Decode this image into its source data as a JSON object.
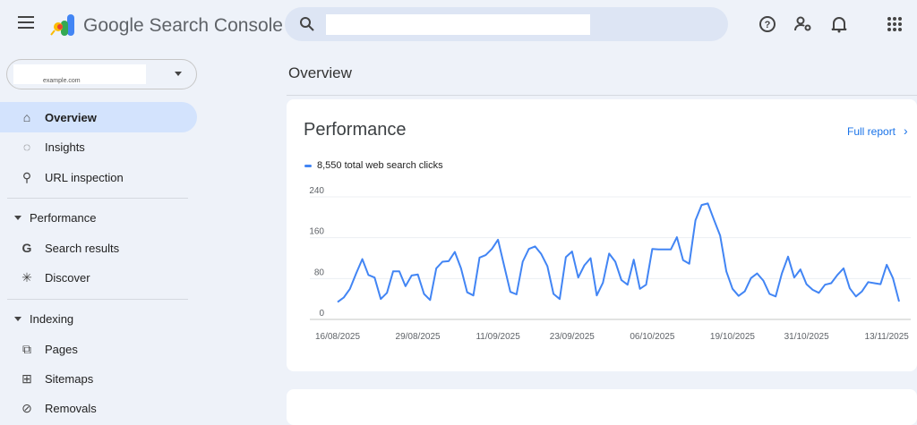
{
  "header": {
    "brand": "Google Search Console",
    "search_placeholder": "",
    "icons": [
      "menu-icon",
      "help-icon",
      "manage-accounts-icon",
      "notifications-icon",
      "apps-grid-icon"
    ]
  },
  "property": {
    "label": "example.com"
  },
  "sidebar": {
    "items": [
      {
        "label": "Overview",
        "icon": "home-icon",
        "selected": true
      },
      {
        "label": "Insights",
        "icon": "lightbulb-icon"
      },
      {
        "label": "URL inspection",
        "icon": "search-icon"
      }
    ],
    "performance": {
      "label": "Performance",
      "items": [
        {
          "label": "Search results",
          "icon": "google-g-icon"
        },
        {
          "label": "Discover",
          "icon": "asterisk-icon"
        }
      ]
    },
    "indexing": {
      "label": "Indexing",
      "items": [
        {
          "label": "Pages",
          "icon": "pages-icon"
        },
        {
          "label": "Sitemaps",
          "icon": "sitemap-icon"
        },
        {
          "label": "Removals",
          "icon": "eye-off-icon"
        }
      ]
    }
  },
  "main": {
    "title": "Overview",
    "card": {
      "title": "Performance",
      "full_report": "Full report"
    }
  },
  "colors": {
    "accent": "#1a73e8",
    "series": "#4285f4",
    "selected_nav": "#d3e3fd"
  },
  "chart_data": {
    "type": "line",
    "legend": "8,550 total web search clicks",
    "x_start": "16/08/2025",
    "x_end": "15/11/2025",
    "xticks": [
      "16/08/2025",
      "29/08/2025",
      "11/09/2025",
      "23/09/2025",
      "06/10/2025",
      "19/10/2025",
      "31/10/2025",
      "13/11/2025"
    ],
    "yticks": [
      0,
      80,
      160,
      240
    ],
    "ylim": [
      0,
      240
    ],
    "grid": true,
    "values": [
      34,
      43,
      60,
      90,
      118,
      87,
      82,
      40,
      52,
      94,
      94,
      65,
      86,
      88,
      50,
      38,
      100,
      113,
      114,
      132,
      100,
      53,
      47,
      121,
      126,
      138,
      156,
      105,
      54,
      49,
      113,
      138,
      143,
      128,
      104,
      50,
      40,
      122,
      133,
      82,
      106,
      120,
      47,
      72,
      129,
      113,
      77,
      68,
      117,
      60,
      68,
      138,
      137,
      137,
      137,
      161,
      116,
      109,
      194,
      224,
      227,
      195,
      164,
      94,
      60,
      46,
      55,
      81,
      90,
      76,
      50,
      45,
      90,
      123,
      82,
      98,
      69,
      58,
      52,
      68,
      71,
      87,
      100,
      61,
      45,
      55,
      73,
      71,
      69,
      107,
      81,
      35
    ]
  }
}
